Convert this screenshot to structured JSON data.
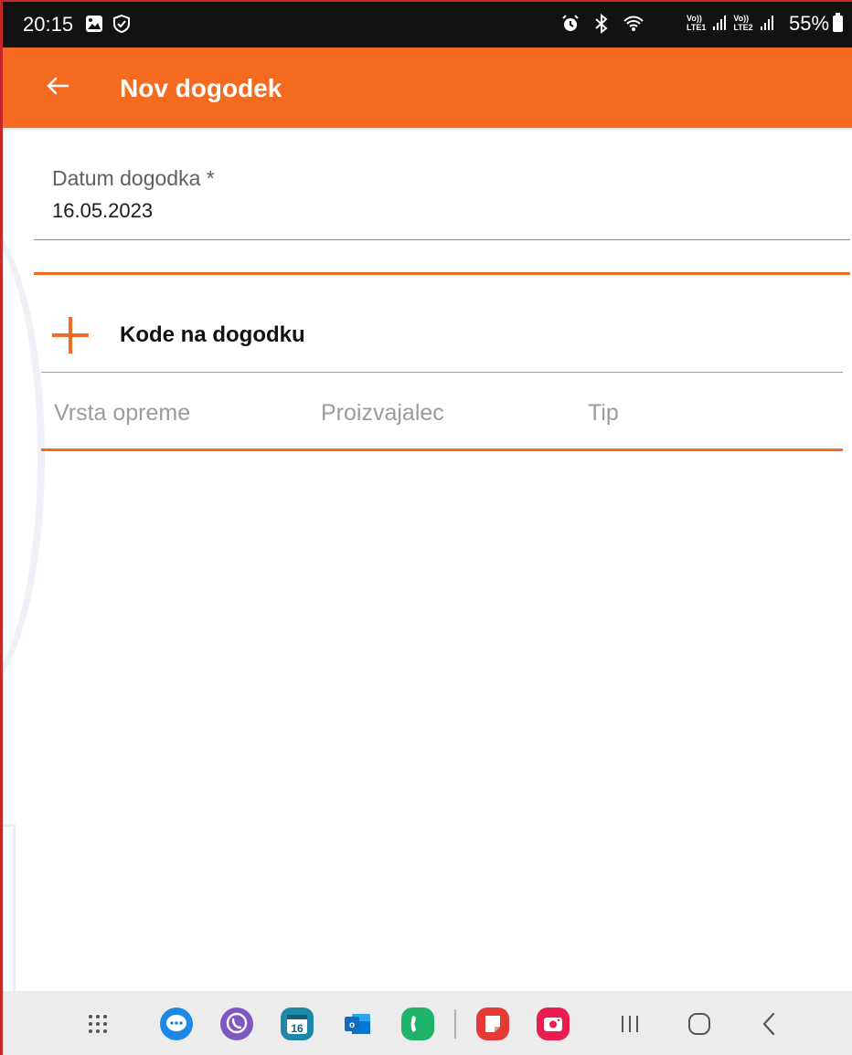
{
  "status_bar": {
    "time": "20:15",
    "battery": "55%",
    "lte1": "LTE1",
    "lte2": "LTE2",
    "vol": "Vo))"
  },
  "app_bar": {
    "title": "Nov dogodek",
    "back_icon": "arrow-left-icon"
  },
  "form": {
    "date_label": "Datum dogodka *",
    "date_value": "16.05.2023"
  },
  "codes": {
    "add_label": "Kode na dogodku",
    "columns": [
      "Vrsta opreme",
      "Proizvajalec",
      "Tip"
    ]
  },
  "colors": {
    "accent": "#f46b20",
    "status_bar": "#121212",
    "nav_bar": "#ececec"
  },
  "nav_bar": {
    "apps": [
      "apps-grid-icon",
      "messages-icon",
      "viber-icon",
      "calendar-icon",
      "outlook-icon",
      "phone-icon",
      "notes-icon",
      "camera-icon"
    ],
    "calendar_day": "16",
    "controls": [
      "recents-icon",
      "home-icon",
      "back-icon"
    ]
  }
}
